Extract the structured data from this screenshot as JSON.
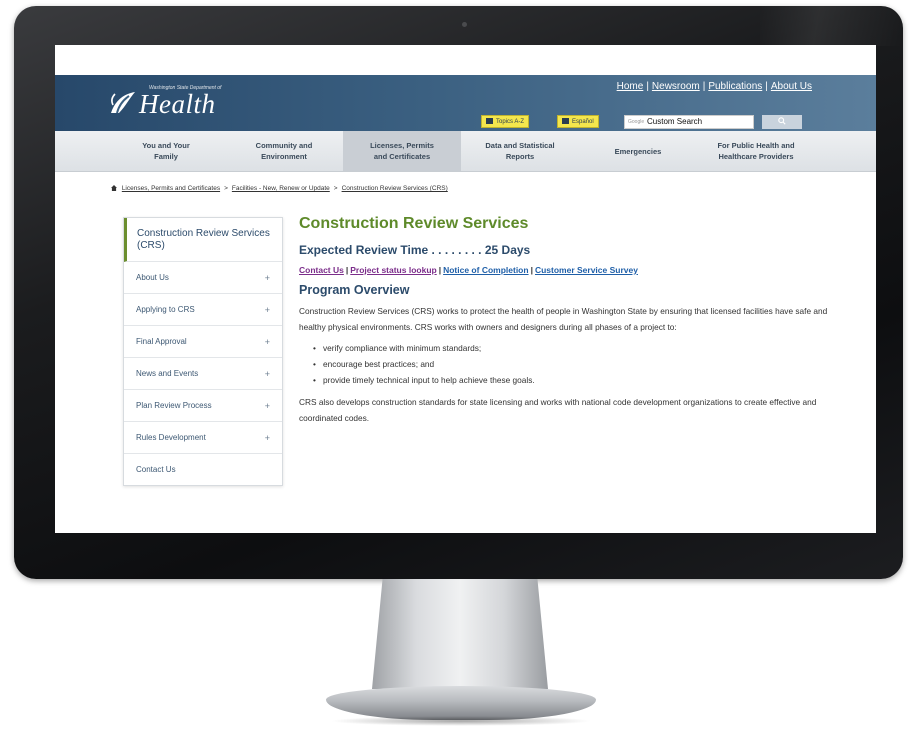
{
  "header": {
    "logo_small": "Washington State Department of",
    "logo_text": "Health",
    "utility_links": [
      "Home",
      "Newsroom",
      "Publications",
      "About Us"
    ],
    "topics_label": "Topics A-Z",
    "espanol_label": "Español",
    "search_google": "Google",
    "search_placeholder": "Custom Search"
  },
  "nav": [
    {
      "label": "You and Your\nFamily"
    },
    {
      "label": "Community and\nEnvironment"
    },
    {
      "label": "Licenses, Permits\nand Certificates"
    },
    {
      "label": "Data and Statistical\nReports"
    },
    {
      "label": "Emergencies"
    },
    {
      "label": "For Public Health and\nHealthcare Providers"
    }
  ],
  "breadcrumb": [
    "Licenses, Permits and Certificates",
    "Facilities - New, Renew or Update",
    "Construction Review Services (CRS)"
  ],
  "sidebar": {
    "title": "Construction Review Services (CRS)",
    "items": [
      {
        "label": "About Us",
        "expand": "+"
      },
      {
        "label": "Applying to CRS",
        "expand": "+"
      },
      {
        "label": "Final Approval",
        "expand": "+"
      },
      {
        "label": "News and Events",
        "expand": "+"
      },
      {
        "label": "Plan Review Process",
        "expand": "+"
      },
      {
        "label": "Rules Development",
        "expand": "+"
      },
      {
        "label": "Contact Us",
        "expand": ""
      }
    ]
  },
  "main": {
    "title": "Construction Review Services",
    "review_time": "Expected Review Time . . . . . . . . 25 Days",
    "links": [
      "Contact Us",
      "Project status lookup",
      "Notice of Completion",
      "Customer Service Survey"
    ],
    "overview_title": "Program Overview",
    "paragraph1": "Construction Review Services (CRS) works to protect the health of people in Washington State by ensuring that licensed facilities have safe and healthy physical environments. CRS works with owners and designers during all phases of a project to:",
    "bullets": [
      "verify compliance with minimum standards;",
      "encourage best practices; and",
      "provide timely technical input to help achieve these goals."
    ],
    "paragraph2": "CRS also develops construction standards for state licensing and works with national code development organizations to create effective and coordinated codes."
  },
  "colors": {
    "header_blue": "#27486a",
    "title_green": "#5e8a2a",
    "link_purple": "#7b2d8a",
    "accent_yellow": "#f4e64d"
  }
}
